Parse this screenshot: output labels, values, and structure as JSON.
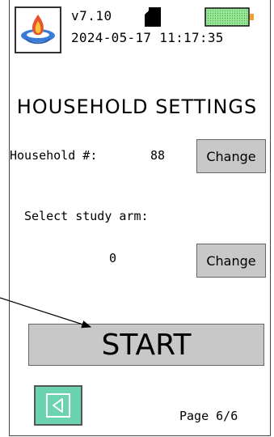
{
  "header": {
    "version": "v7.10",
    "datetime": "2024-05-17 11:17:35",
    "logo_icon": "flame-logo-icon",
    "storage_icon": "sd-card-icon",
    "battery_icon": "battery-icon",
    "battery_color": "#7ddc7d"
  },
  "title": "HOUSEHOLD SETTINGS",
  "household": {
    "label": "Household #:",
    "value": "88",
    "change_label": "Change"
  },
  "study_arm": {
    "label": "Select study arm:",
    "value": "0",
    "change_label": "Change"
  },
  "start_label": "START",
  "footer": {
    "back_icon": "back-arrow-icon",
    "back_color": "#6bd3b1",
    "page_indicator": "Page 6/6"
  }
}
